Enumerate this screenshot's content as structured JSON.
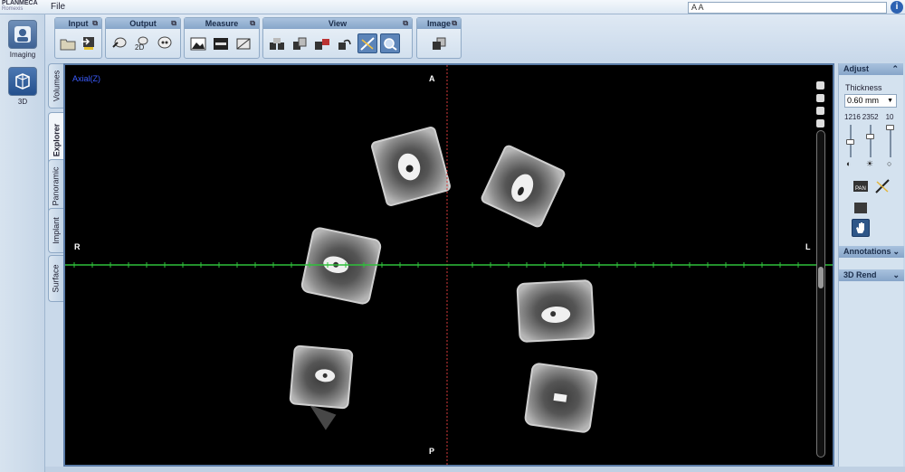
{
  "app": {
    "brand": "PLANMECA",
    "brand_sub": "Romexis",
    "menu_file": "File"
  },
  "search": {
    "value": "A A"
  },
  "info_icon": "info-icon",
  "modes": [
    {
      "label": "Imaging",
      "icon": "portrait-icon"
    },
    {
      "label": "3D",
      "icon": "3d-volume-icon"
    }
  ],
  "toolbar": {
    "groups": [
      {
        "title": "Input",
        "icons": [
          "folder-open-icon",
          "import-icon"
        ]
      },
      {
        "title": "Output",
        "icons": [
          "export-skull-icon",
          "2d-icon",
          "skull-icon"
        ]
      },
      {
        "title": "Measure",
        "icons": [
          "image-landscape-icon",
          "ruler-icon",
          "crop-icon"
        ]
      },
      {
        "title": "View",
        "icons": [
          "layout-1-icon",
          "layout-2-icon",
          "layout-3-icon",
          "undo-icon",
          "contrast-icon",
          "zoom-icon"
        ]
      },
      {
        "title": "Image",
        "icons": [
          "copy-icon"
        ]
      }
    ]
  },
  "side_tabs": [
    "Volumes",
    "Explorer",
    "Panoramic",
    "Implant",
    "Surface"
  ],
  "active_tab": "Explorer",
  "viewer": {
    "slice_label": "Axial(Z)",
    "orientation": {
      "top": "A",
      "bottom": "P",
      "left": "R",
      "right": "L"
    }
  },
  "adjust_panel": {
    "title": "Adjust",
    "thickness_label": "Thickness",
    "thickness_value": "0.60 mm",
    "values": [
      "1216",
      "2352",
      "10"
    ],
    "tools": [
      "pan-icon",
      "window-level-icon",
      "rectangle-icon",
      "hand-icon"
    ],
    "sections": [
      "Annotations",
      "3D Rend"
    ]
  }
}
